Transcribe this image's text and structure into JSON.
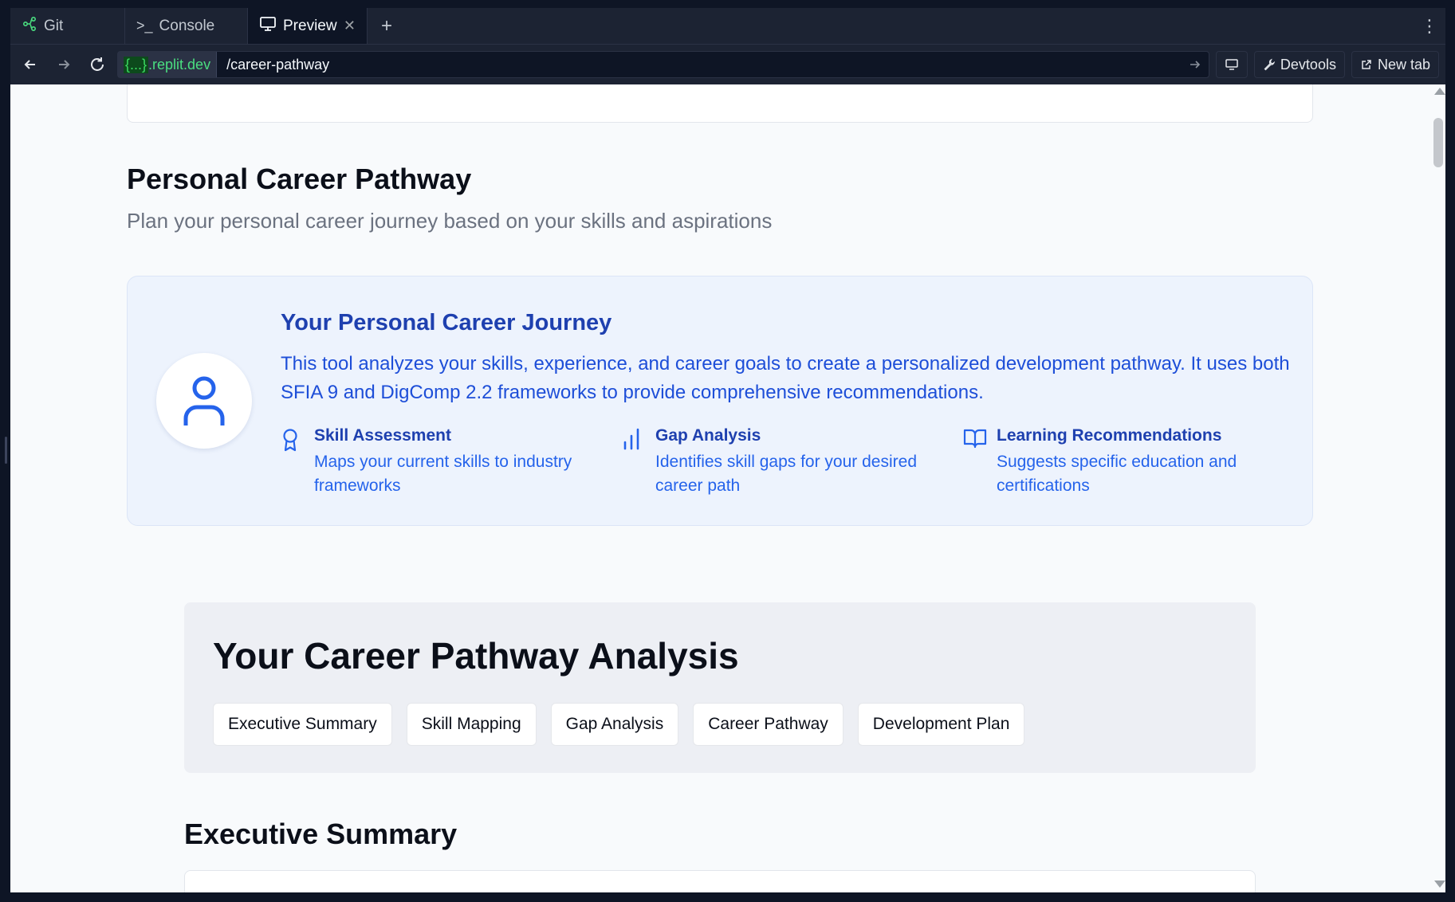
{
  "browser": {
    "tabs": [
      {
        "label": "Git",
        "icon": "git-icon"
      },
      {
        "label": "Console",
        "icon": "terminal-icon"
      },
      {
        "label": "Preview",
        "icon": "monitor-icon",
        "active": true
      }
    ],
    "add_tab": "+",
    "menu": "⋮",
    "url_host_braces": "{...}",
    "url_host": ".replit.dev",
    "url_path": "/career-pathway",
    "devtools_label": "Devtools",
    "newtab_label": "New tab"
  },
  "page": {
    "title": "Personal Career Pathway",
    "subtitle": "Plan your personal career journey based on your skills and aspirations",
    "journey": {
      "title": "Your Personal Career Journey",
      "description": "This tool analyzes your skills, experience, and career goals to create a personalized development pathway. It uses both SFIA 9 and DigComp 2.2 frameworks to provide comprehensive recommendations.",
      "features": [
        {
          "title": "Skill Assessment",
          "desc": "Maps your current skills to industry frameworks",
          "icon": "award-icon"
        },
        {
          "title": "Gap Analysis",
          "desc": "Identifies skill gaps for your desired career path",
          "icon": "bar-chart-icon"
        },
        {
          "title": "Learning Recommendations",
          "desc": "Suggests specific education and certifications",
          "icon": "book-open-icon"
        }
      ]
    },
    "analysis": {
      "title": "Your Career Pathway Analysis",
      "tabs": [
        "Executive Summary",
        "Skill Mapping",
        "Gap Analysis",
        "Career Pathway",
        "Development Plan"
      ]
    },
    "exec_title": "Executive Summary"
  },
  "colors": {
    "accent_blue": "#1e40af",
    "link_blue": "#2563eb",
    "host_green": "#4ade80"
  }
}
